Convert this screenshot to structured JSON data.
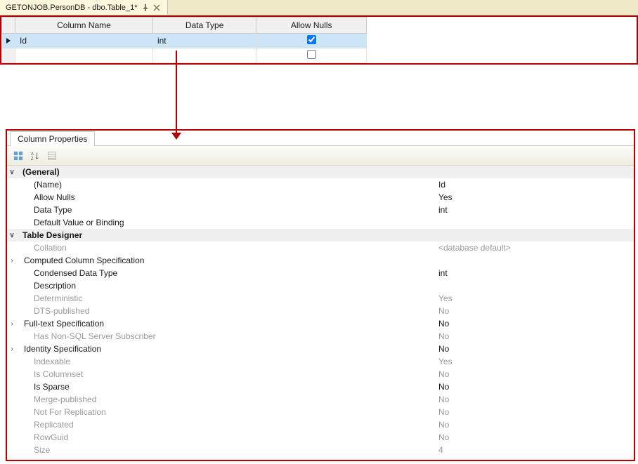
{
  "tab": {
    "title": "GETONJOB.PersonDB - dbo.Table_1*"
  },
  "designer": {
    "headers": {
      "col": "Column Name",
      "type": "Data Type",
      "nulls": "Allow Nulls"
    },
    "rows": [
      {
        "name": "Id",
        "type": "int",
        "allow_nulls": true,
        "selected": true
      },
      {
        "name": "",
        "type": "",
        "allow_nulls": false,
        "selected": false
      }
    ]
  },
  "properties": {
    "panel_title": "Column Properties",
    "sections": [
      {
        "label": "(General)",
        "expanded": true,
        "rows": [
          {
            "name": "(Name)",
            "value": "Id"
          },
          {
            "name": "Allow Nulls",
            "value": "Yes"
          },
          {
            "name": "Data Type",
            "value": "int"
          },
          {
            "name": "Default Value or Binding",
            "value": ""
          }
        ]
      },
      {
        "label": "Table Designer",
        "expanded": true,
        "rows": [
          {
            "name": "Collation",
            "value": "<database default>",
            "disabled": true
          },
          {
            "name": "Computed Column Specification",
            "value": "",
            "expandable": true
          },
          {
            "name": "Condensed Data Type",
            "value": "int"
          },
          {
            "name": "Description",
            "value": ""
          },
          {
            "name": "Deterministic",
            "value": "Yes",
            "disabled": true
          },
          {
            "name": "DTS-published",
            "value": "No",
            "disabled": true
          },
          {
            "name": "Full-text Specification",
            "value": "No",
            "expandable": true
          },
          {
            "name": "Has Non-SQL Server Subscriber",
            "value": "No",
            "disabled": true
          },
          {
            "name": "Identity Specification",
            "value": "No",
            "expandable": true
          },
          {
            "name": "Indexable",
            "value": "Yes",
            "disabled": true
          },
          {
            "name": "Is Columnset",
            "value": "No",
            "disabled": true
          },
          {
            "name": "Is Sparse",
            "value": "No"
          },
          {
            "name": "Merge-published",
            "value": "No",
            "disabled": true
          },
          {
            "name": "Not For Replication",
            "value": "No",
            "disabled": true
          },
          {
            "name": "Replicated",
            "value": "No",
            "disabled": true
          },
          {
            "name": "RowGuid",
            "value": "No",
            "disabled": true
          },
          {
            "name": "Size",
            "value": "4",
            "disabled": true
          }
        ]
      }
    ]
  },
  "toolbar_icons": {
    "categorized": "categorized-icon",
    "alphabetical": "alphabetical-icon",
    "propertypages": "property-pages-icon"
  }
}
